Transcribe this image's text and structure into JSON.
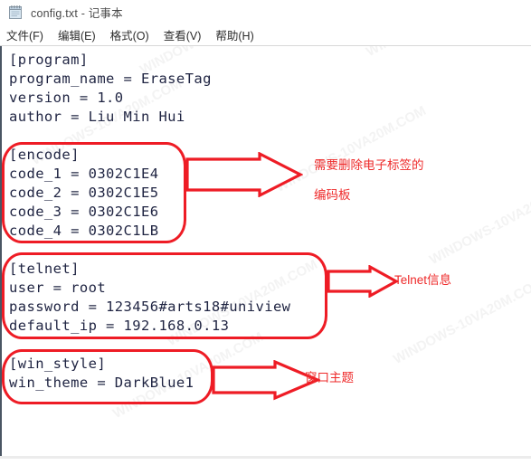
{
  "window": {
    "title": "config.txt - 记事本",
    "icon": "notepad-icon",
    "menu": [
      {
        "label": "文件(F)"
      },
      {
        "label": "编辑(E)"
      },
      {
        "label": "格式(O)"
      },
      {
        "label": "查看(V)"
      },
      {
        "label": "帮助(H)"
      }
    ]
  },
  "editor": {
    "lines": [
      "[program]",
      "program_name = EraseTag",
      "version = 1.0",
      "author = Liu Min Hui",
      "",
      "[encode]",
      "code_1 = 0302C1E4",
      "code_2 = 0302C1E5",
      "code_3 = 0302C1E6",
      "code_4 = 0302C1LB",
      "",
      "[telnet]",
      "user = root",
      "password = 123456#arts18#uniview",
      "default_ip = 192.168.0.13",
      "",
      "[win_style]",
      "win_theme = DarkBlue1"
    ]
  },
  "annotations": {
    "accent_color": "#ee1c25",
    "items": [
      {
        "id": "encode-callout",
        "text_lines": [
          "需要删除电子标签的",
          "编码板"
        ]
      },
      {
        "id": "telnet-callout",
        "text_lines": [
          "Telnet信息"
        ]
      },
      {
        "id": "winstyle-callout",
        "text_lines": [
          "窗口主题"
        ]
      }
    ]
  },
  "watermarks": [
    "WINDOWS-10VA20M.COM",
    "WINDOWS-10VA20M.COM",
    "WINDOWS-10VA20M.COM",
    "WINDOWS-10VA20M.COM",
    "WINDOWS-10VA20M.COM",
    "WINDOWS-10VA20M.COM",
    "WINDOWS-10VA20M.COM",
    "WINDOWS-10VA20M.COM"
  ]
}
